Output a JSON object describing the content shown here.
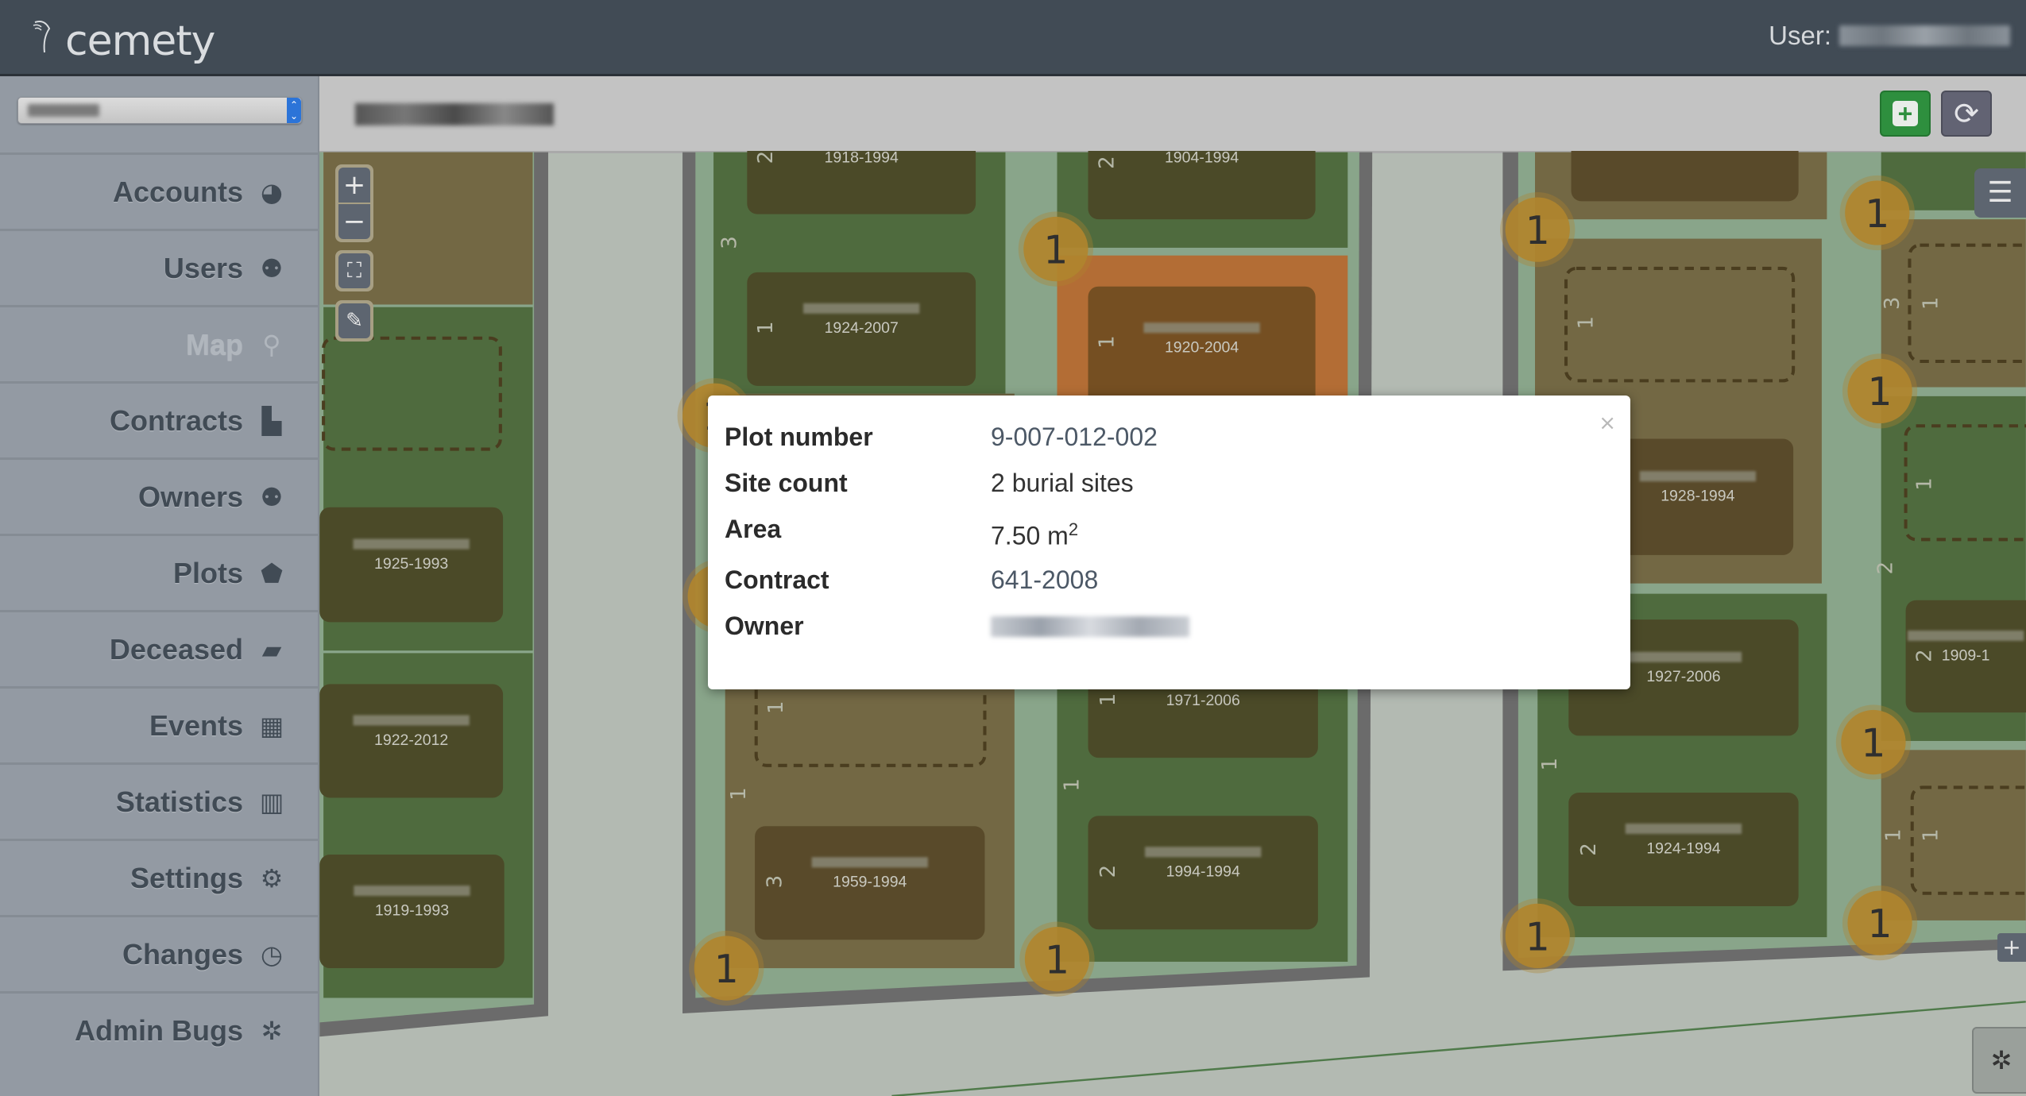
{
  "app": {
    "logo": "cemety",
    "user_label": "User:"
  },
  "sidebar": {
    "items": [
      {
        "label": "Accounts",
        "icon": "globe-icon",
        "glyph": "◕"
      },
      {
        "label": "Users",
        "icon": "users-icon",
        "glyph": "⚉"
      },
      {
        "label": "Map",
        "icon": "map-marker-icon",
        "glyph": "⚲",
        "active": true
      },
      {
        "label": "Contracts",
        "icon": "file-icon",
        "glyph": "▙"
      },
      {
        "label": "Owners",
        "icon": "users-icon",
        "glyph": "⚉"
      },
      {
        "label": "Plots",
        "icon": "tag-icon",
        "glyph": "⬟"
      },
      {
        "label": "Deceased",
        "icon": "book-icon",
        "glyph": "▰"
      },
      {
        "label": "Events",
        "icon": "calendar-icon",
        "glyph": "▦"
      },
      {
        "label": "Statistics",
        "icon": "bar-chart-icon",
        "glyph": "▥"
      },
      {
        "label": "Settings",
        "icon": "gears-icon",
        "glyph": "⚙"
      },
      {
        "label": "Changes",
        "icon": "clock-icon",
        "glyph": "◷"
      },
      {
        "label": "Admin Bugs",
        "icon": "bug-icon",
        "glyph": "✲"
      }
    ]
  },
  "toolbar": {
    "add_icon": "plus-square-icon",
    "add_glyph": "+",
    "refresh_icon": "refresh-icon",
    "refresh_glyph": "⟳"
  },
  "map_controls": {
    "zoom_in": "+",
    "zoom_out": "−",
    "fullscreen": "⛶",
    "draw": "✎",
    "layers": "☰",
    "expand": "+",
    "bug": "✲"
  },
  "popup": {
    "close": "×",
    "rows": [
      {
        "label": "Plot number",
        "value": "9-007-012-002"
      },
      {
        "label": "Site count",
        "value": "2 burial sites"
      },
      {
        "label": "Area",
        "value": "7.50 m",
        "sup": "2"
      },
      {
        "label": "Contract",
        "value": "641-2008"
      },
      {
        "label": "Owner"
      }
    ]
  },
  "map": {
    "grave_years": [
      "1918-1994",
      "1924-2007",
      "1904-1994",
      "1920-2004",
      "1971-2006",
      "1994-1994",
      "1959-1994",
      "1925-1993",
      "1922-2012",
      "1919-1993",
      "1928-1994",
      "1927-2006",
      "1924-1994",
      "1909-1"
    ],
    "row_labels": [
      "3",
      "2",
      "1",
      "2",
      "1",
      "1",
      "1",
      "2",
      "3",
      "1",
      "1",
      "1",
      "1",
      "2",
      "3",
      "1",
      "1",
      "2",
      "2",
      "1",
      "1"
    ],
    "cluster_counts": [
      "1",
      "1",
      "1",
      "1",
      "1",
      "1",
      "1",
      "1",
      "1",
      "1",
      "1"
    ],
    "colors": {
      "plot_green": "#4f6b3e",
      "plot_olive": "#736844",
      "plot_selected": "#b36d35",
      "cluster": "#b0852e"
    }
  }
}
